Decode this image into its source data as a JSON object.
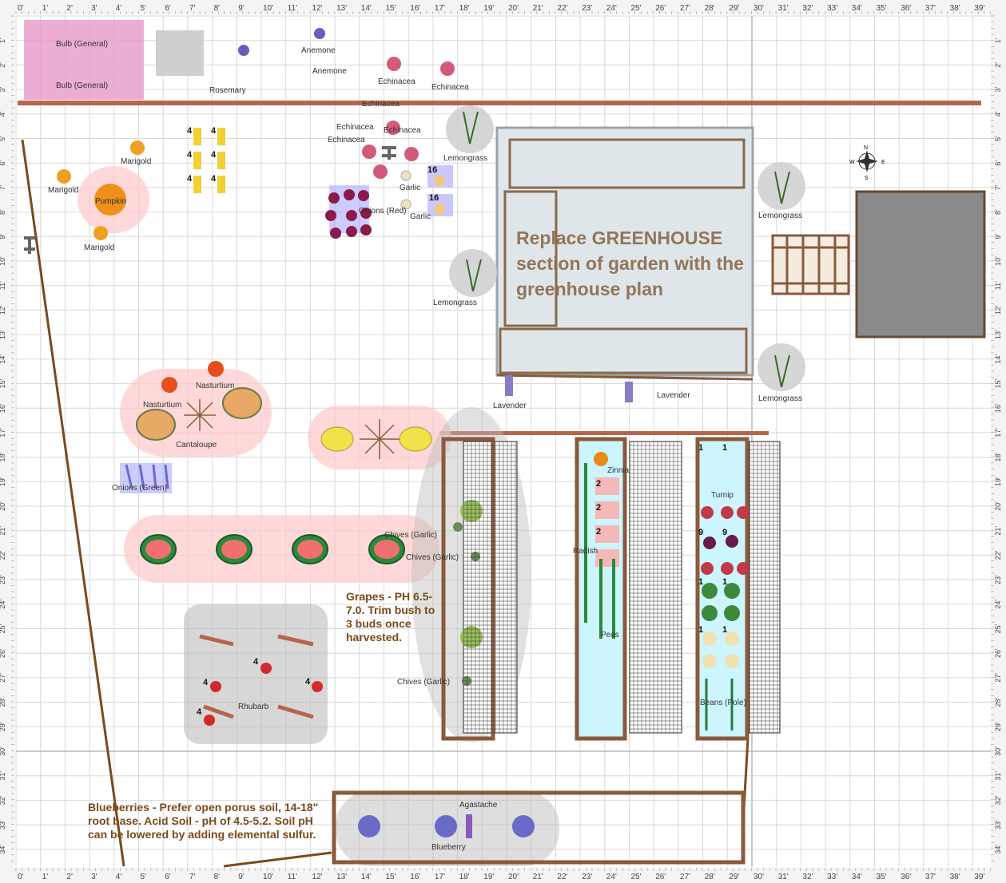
{
  "rulers": {
    "top": [
      "0'",
      "1'",
      "2'",
      "3'",
      "4'",
      "5'",
      "6'",
      "7'",
      "8'",
      "9'",
      "10'",
      "11'",
      "12'",
      "13'",
      "14'",
      "15'",
      "16'",
      "17'",
      "18'",
      "19'",
      "20'",
      "21'",
      "22'",
      "23'",
      "24'",
      "25'",
      "26'",
      "27'",
      "28'",
      "29'",
      "30'",
      "31'",
      "32'",
      "33'",
      "34'",
      "35'",
      "36'",
      "37'",
      "38'",
      "39'"
    ],
    "side": [
      "1'",
      "2'",
      "3'",
      "4'",
      "5'",
      "6'",
      "7'",
      "8'",
      "9'",
      "10'",
      "11'",
      "12'",
      "13'",
      "14'",
      "15'",
      "16'",
      "17'",
      "18'",
      "19'",
      "20'",
      "21'",
      "22'",
      "23'",
      "24'",
      "25'",
      "26'",
      "27'",
      "28'",
      "29'",
      "30'",
      "31'",
      "32'",
      "33'",
      "34'"
    ]
  },
  "plants": {
    "bulb_1": "Bulb (General)",
    "bulb_2": "Bulb (General)",
    "rosemary": "Rosemary",
    "anemone_1": "Anemone",
    "anemone_2": "Anemone",
    "echinacea_1": "Echinacea",
    "echinacea_2": "Echinacea",
    "echinacea_3": "Echinacea",
    "echinacea_4": "Echinacea",
    "echinacea_5": "Echinacea",
    "echinacea_6": "Echinacea",
    "marigold_1": "Marigold",
    "marigold_2": "Marigold",
    "marigold_3": "Marigold",
    "pumpkin": "Pumpkin",
    "garlic_1": "Garlic",
    "garlic_2": "Garlic",
    "onions_red": "Onions (Red)",
    "lemongrass_1": "Lemongrass",
    "lemongrass_2": "Lemongrass",
    "lemongrass_3": "Lemongrass",
    "lemongrass_4": "Lemongrass",
    "lavender_1": "Lavender",
    "lavender_2": "Lavender",
    "nasturtium_1": "Nasturtium",
    "nasturtium_2": "Nasturtium",
    "cantaloupe": "Cantaloupe",
    "onions_green": "Onions (Green)",
    "chives_1": "Chives (Garlic)",
    "chives_2": "Chives (Garlic)",
    "chives_3": "Chives (Garlic)",
    "rhubarb": "Rhubarb",
    "zinnia": "Zinnia",
    "radish": "Radish",
    "peas": "Peas",
    "turnip": "Turnip",
    "beans": "Beans (Pole)",
    "agastache": "Agastache",
    "blueberry": "Blueberry"
  },
  "counts": {
    "corn": "4",
    "garlic": "16",
    "strawberry": "4",
    "radish": "2",
    "zinnia": "1",
    "turnip": "9",
    "cabbage": "1"
  },
  "notes": {
    "greenhouse": "Replace GREENHOUSE section of garden with the greenhouse plan",
    "grapes": "Grapes - PH 6.5-7.0. Trim bush to 3 buds once harvested.",
    "blueberries": "Blueberries - Prefer open porus soil, 14-18\" root base. Acid Soil - pH of 4.5-5.2. Soil pH can be lowered by adding elemental sulfur."
  },
  "compass": {
    "n": "N",
    "s": "S",
    "e": "E",
    "w": "W"
  },
  "colors": {
    "grid": "#d9d9d9",
    "grid_major": "#b8b8b8",
    "fence": "#b5654c",
    "wood": "#8a5a3c",
    "highlight": "#ffb3b3",
    "note_text": "#7a4a1c"
  }
}
